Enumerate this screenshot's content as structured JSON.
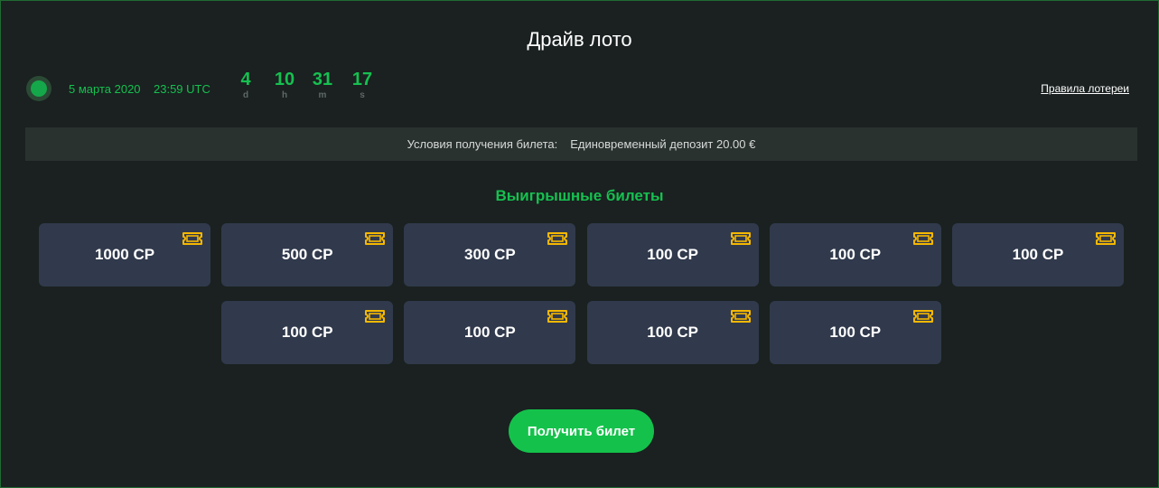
{
  "header": {
    "title": "Драйв лото"
  },
  "draw": {
    "date": "5 марта 2020",
    "time": "23:59 UTC",
    "countdown": [
      {
        "value": "4",
        "unit": "d"
      },
      {
        "value": "10",
        "unit": "h"
      },
      {
        "value": "31",
        "unit": "m"
      },
      {
        "value": "17",
        "unit": "s"
      }
    ],
    "rules_link": "Правила лотереи"
  },
  "conditions": {
    "label": "Условия получения билета:",
    "value": "Единовременный депозит 20.00 €"
  },
  "prizes": {
    "title": "Выигрышные билеты",
    "tickets": [
      {
        "label": "1000 CP"
      },
      {
        "label": "500 CP"
      },
      {
        "label": "300 CP"
      },
      {
        "label": "100 CP"
      },
      {
        "label": "100 CP"
      },
      {
        "label": "100 CP"
      },
      {
        "label": "100 CP"
      },
      {
        "label": "100 CP"
      },
      {
        "label": "100 CP"
      },
      {
        "label": "100 CP"
      }
    ],
    "ticket_icon": "ticket-icon",
    "ticket_icon_color": "#f5b800"
  },
  "actions": {
    "get_ticket": "Получить билет"
  },
  "colors": {
    "accent": "#16c050",
    "background": "#1a2120",
    "ticket_bg": "#313a4c",
    "button": "#14c24b"
  }
}
